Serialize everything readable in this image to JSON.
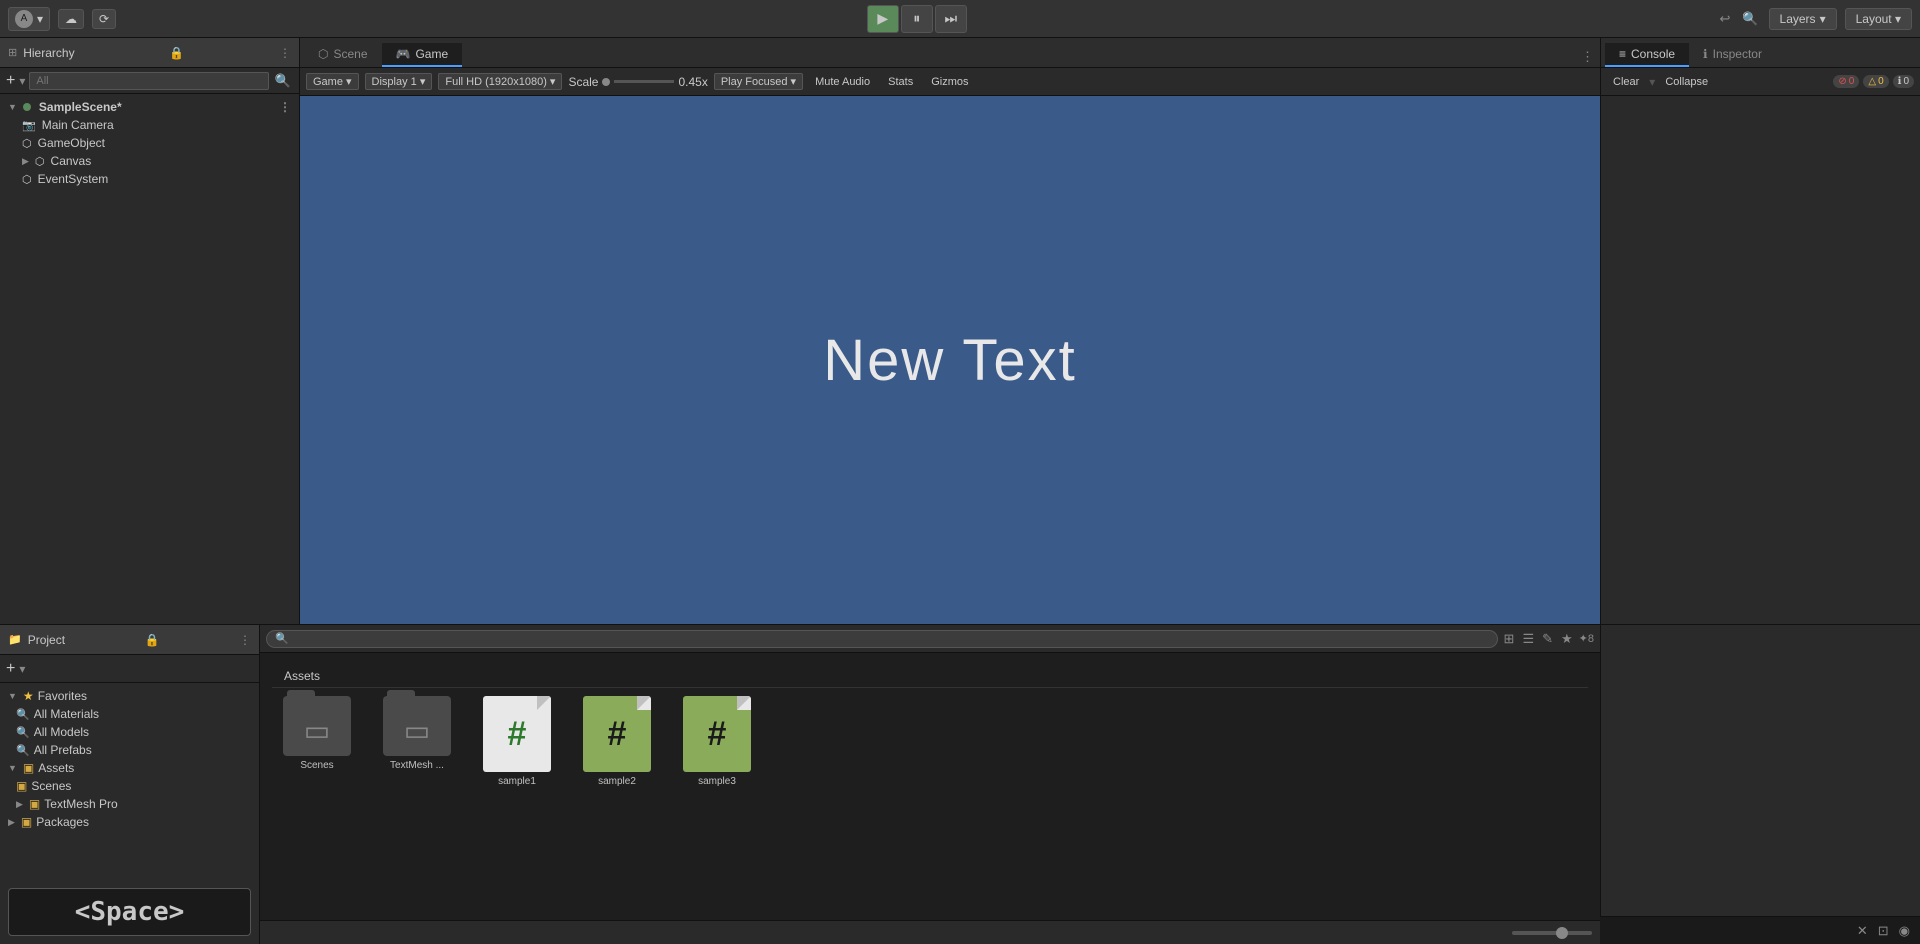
{
  "topbar": {
    "account": "A",
    "layers_label": "Layers",
    "layout_label": "Layout"
  },
  "hierarchy": {
    "title": "Hierarchy",
    "toolbar": {
      "add_btn": "+",
      "search_placeholder": "All"
    },
    "scene": "SampleScene*",
    "items": [
      {
        "label": "Main Camera",
        "depth": 1,
        "icon": "camera"
      },
      {
        "label": "GameObject",
        "depth": 1,
        "icon": "cube"
      },
      {
        "label": "Canvas",
        "depth": 1,
        "icon": "canvas",
        "expanded": true
      },
      {
        "label": "EventSystem",
        "depth": 1,
        "icon": "event"
      }
    ]
  },
  "tabs": {
    "scene_label": "Scene",
    "game_label": "Game"
  },
  "game_toolbar": {
    "game_label": "Game",
    "display_label": "Display 1",
    "resolution_label": "Full HD (1920x1080)",
    "scale_label": "Scale",
    "scale_value": "0.45x",
    "play_focused_label": "Play Focused",
    "mute_audio_label": "Mute Audio",
    "stats_label": "Stats",
    "gizmos_label": "Gizmos"
  },
  "game_view": {
    "text": "New Text",
    "bg_color": "#3a5a8a"
  },
  "inspector": {
    "title": "Inspector"
  },
  "console": {
    "title": "Console",
    "clear_label": "Clear",
    "collapse_label": "Collapse",
    "error_count": "0",
    "warn_count": "0",
    "info_count": "0"
  },
  "project": {
    "title": "Project",
    "favorites": {
      "label": "Favorites",
      "items": [
        {
          "label": "All Materials"
        },
        {
          "label": "All Models"
        },
        {
          "label": "All Prefabs"
        }
      ]
    },
    "assets": {
      "label": "Assets",
      "items": [
        {
          "label": "Scenes"
        },
        {
          "label": "TextMesh Pro"
        },
        {
          "label": "Packages"
        }
      ]
    }
  },
  "assets_view": {
    "header": "Assets",
    "items": [
      {
        "label": "Scenes",
        "type": "folder"
      },
      {
        "label": "TextMesh ...",
        "type": "folder"
      },
      {
        "label": "sample1",
        "type": "script"
      },
      {
        "label": "sample2",
        "type": "script"
      },
      {
        "label": "sample3",
        "type": "script"
      }
    ]
  },
  "space_indicator": {
    "label": "<Space>"
  },
  "bottom_icons": {
    "count": "8"
  }
}
